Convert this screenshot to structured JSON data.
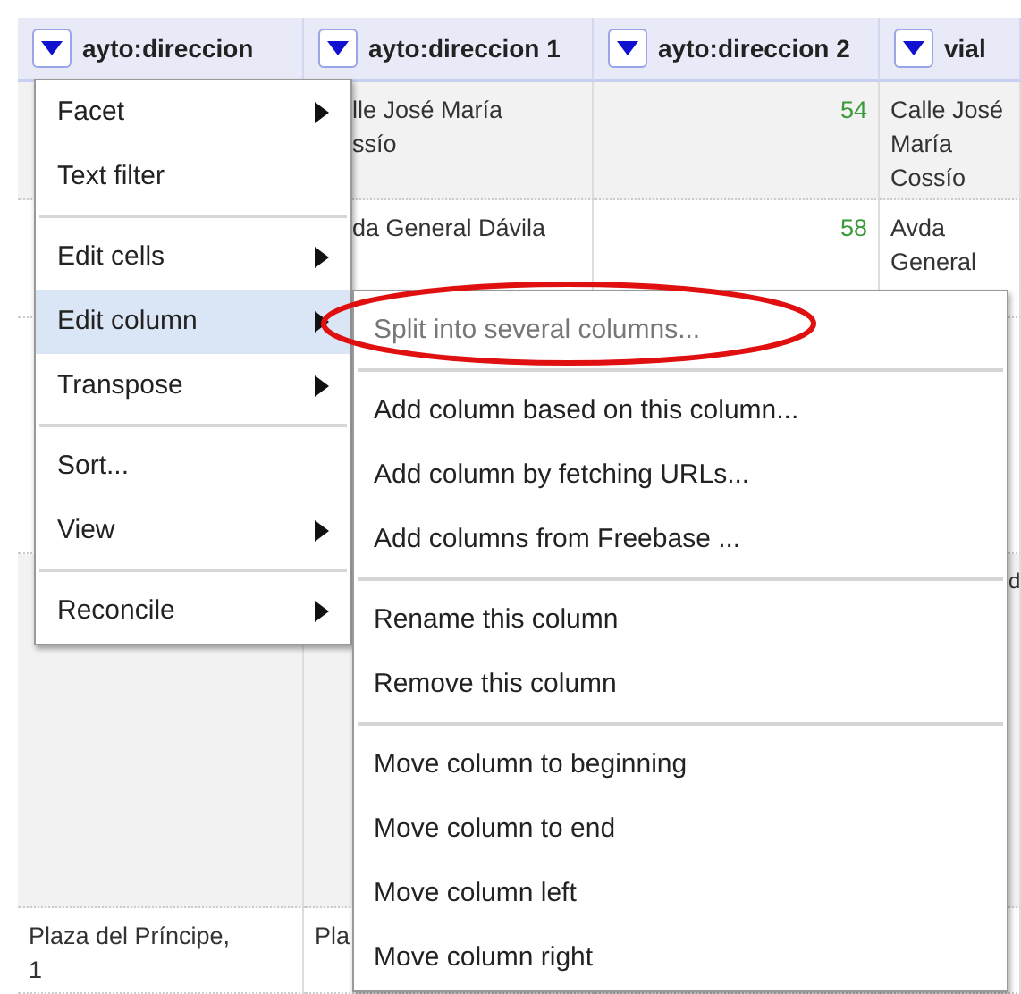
{
  "table": {
    "columns": [
      {
        "label": "ayto:direccion"
      },
      {
        "label": "ayto:direccion 1"
      },
      {
        "label": "ayto:direccion 2"
      },
      {
        "label": "vial"
      }
    ],
    "rows": [
      {
        "cells": [
          "",
          "lle José María\nssío",
          "54",
          "Calle José María Cossío"
        ]
      },
      {
        "cells": [
          "",
          "da General Dávila",
          "58",
          "Avda\nGeneral"
        ]
      },
      {
        "cells": [
          "",
          "",
          "",
          ""
        ]
      },
      {
        "cells": [
          "",
          "",
          "",
          "d"
        ]
      },
      {
        "cells": [
          "Plaza del Príncipe,\n1",
          "Pla",
          "",
          ""
        ]
      }
    ]
  },
  "column_menu": {
    "groups": [
      [
        {
          "label": "Facet",
          "submenu": true,
          "selected": false
        },
        {
          "label": "Text filter",
          "submenu": false,
          "selected": false
        }
      ],
      [
        {
          "label": "Edit cells",
          "submenu": true,
          "selected": false
        },
        {
          "label": "Edit column",
          "submenu": true,
          "selected": true
        },
        {
          "label": "Transpose",
          "submenu": true,
          "selected": false
        }
      ],
      [
        {
          "label": "Sort...",
          "submenu": false,
          "selected": false
        },
        {
          "label": "View",
          "submenu": true,
          "selected": false
        }
      ],
      [
        {
          "label": "Reconcile",
          "submenu": true,
          "selected": false
        }
      ]
    ]
  },
  "submenu": {
    "groups": [
      [
        {
          "label": "Split into several columns...",
          "disabled": true
        }
      ],
      [
        {
          "label": "Add column based on this column...",
          "disabled": false
        },
        {
          "label": "Add column by fetching URLs...",
          "disabled": false
        },
        {
          "label": "Add columns from Freebase ...",
          "disabled": false
        }
      ],
      [
        {
          "label": "Rename this column",
          "disabled": false
        },
        {
          "label": "Remove this column",
          "disabled": false
        }
      ],
      [
        {
          "label": "Move column to beginning",
          "disabled": false
        },
        {
          "label": "Move column to end",
          "disabled": false
        },
        {
          "label": "Move column left",
          "disabled": false
        },
        {
          "label": "Move column right",
          "disabled": false
        }
      ]
    ]
  },
  "annotation": {
    "kind": "ellipse",
    "color": "#e01010"
  }
}
